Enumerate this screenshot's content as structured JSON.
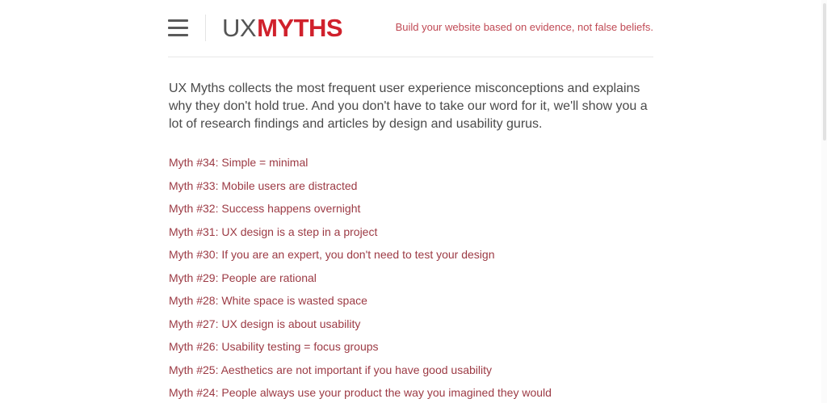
{
  "header": {
    "menu_icon": "hamburger-menu-icon",
    "logo": {
      "part1": "UX",
      "part2": "MYTHS"
    },
    "tagline": "Build your website based on evidence, not false beliefs."
  },
  "intro": "UX Myths collects the most frequent user experience misconceptions and explains why they don't hold true. And you don't have to take our word for it, we'll show you a lot of research findings and articles by design and usability gurus.",
  "myths": [
    "Myth #34: Simple = minimal",
    "Myth #33: Mobile users are distracted",
    "Myth #32: Success happens overnight",
    "Myth #31: UX design is a step in a project",
    "Myth #30: If you are an expert, you don't need to test your design",
    "Myth #29: People are rational",
    "Myth #28: White space is wasted space",
    "Myth #27: UX design is about usability",
    "Myth #26: Usability testing = focus groups",
    "Myth #25: Aesthetics are not important if you have good usability",
    "Myth #24: People always use your product the way you imagined they would"
  ],
  "colors": {
    "brand_red": "#d0212c",
    "link": "#9c3a44",
    "tagline": "#c04a55",
    "text": "#4a4a4a"
  }
}
